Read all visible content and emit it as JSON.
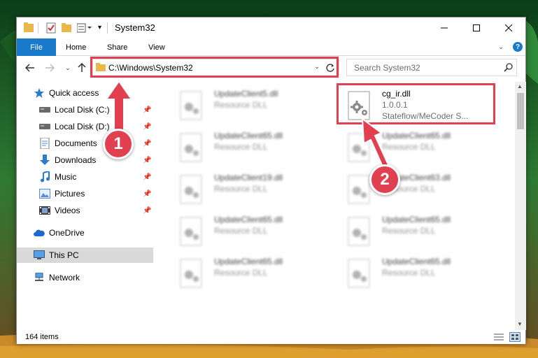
{
  "window": {
    "title": "System32",
    "controls": [
      "minimize-icon",
      "maximize-icon",
      "close-icon"
    ]
  },
  "ribbon": {
    "tabs": [
      "File",
      "Home",
      "Share",
      "View"
    ],
    "help": "?"
  },
  "address": {
    "path": "C:\\Windows\\System32",
    "search_placeholder": "Search System32"
  },
  "nav": {
    "items": [
      {
        "label": "Quick access",
        "icon": "star-icon"
      },
      {
        "label": "Local Disk (C:)",
        "icon": "drive-icon",
        "pinned": true
      },
      {
        "label": "Local Disk (D:)",
        "icon": "drive-icon",
        "pinned": true
      },
      {
        "label": "Documents",
        "icon": "documents-icon",
        "pinned": true
      },
      {
        "label": "Downloads",
        "icon": "download-icon",
        "pinned": true
      },
      {
        "label": "Music",
        "icon": "music-icon",
        "pinned": true
      },
      {
        "label": "Pictures",
        "icon": "pictures-icon",
        "pinned": true
      },
      {
        "label": "Videos",
        "icon": "videos-icon",
        "pinned": true
      },
      {
        "label": "OneDrive",
        "icon": "cloud-icon"
      },
      {
        "label": "This PC",
        "icon": "computer-icon",
        "selected": true
      },
      {
        "label": "Network",
        "icon": "network-icon"
      }
    ]
  },
  "files": [
    {
      "name": "UpdateClient5.dll",
      "type": "Resource DLL"
    },
    {
      "name": "cg_ir.dll",
      "version": "1.0.0.1",
      "description": "Stateflow/MeCoder S..."
    },
    {
      "name": "UpdateClient65.dll",
      "type": "Resource DLL"
    },
    {
      "name": "UpdateClient65.dll",
      "type": "Resource DLL"
    },
    {
      "name": "UpdateClient19.dll",
      "type": "Resource DLL"
    },
    {
      "name": "UpdateClient63.dll",
      "type": "Resource DLL"
    },
    {
      "name": "UpdateClient65.dll",
      "type": "Resource DLL"
    },
    {
      "name": "UpdateClient65.dll",
      "type": "Resource DLL"
    },
    {
      "name": "UpdateClient65.dll",
      "type": "Resource DLL"
    },
    {
      "name": "UpdateClient65.dll",
      "type": "Resource DLL"
    }
  ],
  "status": {
    "items": "164 items"
  },
  "annotations": {
    "step1": "1",
    "step2": "2",
    "color": "#e04050"
  }
}
